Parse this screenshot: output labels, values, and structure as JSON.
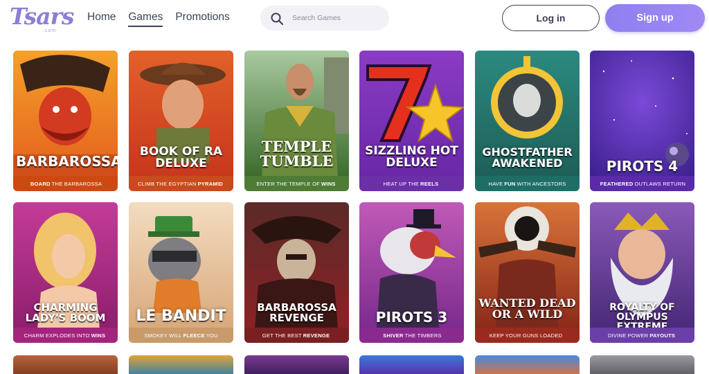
{
  "logo": {
    "text": "Tsars",
    "sub": ".com"
  },
  "nav": [
    {
      "label": "Home"
    },
    {
      "label": "Games"
    },
    {
      "label": "Promotions"
    }
  ],
  "search": {
    "placeholder": "Search Games"
  },
  "auth": {
    "login_label": "Log in",
    "signup_label": "Sign up"
  },
  "games": [
    {
      "title": "BARBAROSSA",
      "caption_pre": "",
      "caption_bold": "BOARD",
      "caption_post": "THE BARBAROSSA",
      "caption_color": "#cc4a12"
    },
    {
      "title": "BOOK OF RA DELUXE",
      "caption_pre": "CLIMB THE EGYPTIAN",
      "caption_bold": "PYRAMID",
      "caption_post": "",
      "caption_color": "#c94a1c"
    },
    {
      "title": "TEMPLE TUMBLE",
      "caption_pre": "ENTER THE TEMPLE OF",
      "caption_bold": "WINS",
      "caption_post": "",
      "caption_color": "#4f7c35"
    },
    {
      "title": "SIZZLING HOT DELUXE",
      "caption_pre": "HEAT UP THE",
      "caption_bold": "REELS",
      "caption_post": "",
      "caption_color": "#6b2fa8"
    },
    {
      "title": "GHOSTFATHER AWAKENED",
      "caption_pre": "HAVE",
      "caption_bold": "FUN",
      "caption_post": "WITH ANCESTORS",
      "caption_color": "#1f6e66"
    },
    {
      "title": "PIROTS 4",
      "caption_pre": "",
      "caption_bold": "FEATHERED",
      "caption_post": "OUTLAWS RETURN",
      "caption_color": "#5a2aa8"
    },
    {
      "title": "CHARMING LADY'S BOOM",
      "caption_pre": "CHARM EXPLODES INTO",
      "caption_bold": "WINS",
      "caption_post": "",
      "caption_color": "#a3247c"
    },
    {
      "title": "LE BANDIT",
      "caption_pre": "SMOKEY WILL",
      "caption_bold": "FLEECE",
      "caption_post": "YOU",
      "caption_color": "#c99a6a"
    },
    {
      "title": "BARBAROSSA REVENGE",
      "caption_pre": "GET THE BEST",
      "caption_bold": "REVENGE",
      "caption_post": "",
      "caption_color": "#7a1f22"
    },
    {
      "title": "PIROTS 3",
      "caption_pre": "",
      "caption_bold": "SHIVER",
      "caption_post": "THE TIMBERS",
      "caption_color": "#8a2a8e"
    },
    {
      "title": "WANTED DEAD OR A WILD",
      "caption_pre": "KEEP YOUR GUNS LOADED",
      "caption_bold": "",
      "caption_post": "",
      "caption_color": "#9a2a1e"
    },
    {
      "title": "ROYALTY OF OLYMPUS EXTREME",
      "caption_pre": "DIVINE POWER",
      "caption_bold": "PAYOUTS",
      "caption_post": "",
      "caption_color": "#6a3fa8"
    }
  ],
  "colors": {
    "accent": "#9584f2",
    "nav_text": "#3d4257",
    "login_border": "#3c3d57"
  }
}
